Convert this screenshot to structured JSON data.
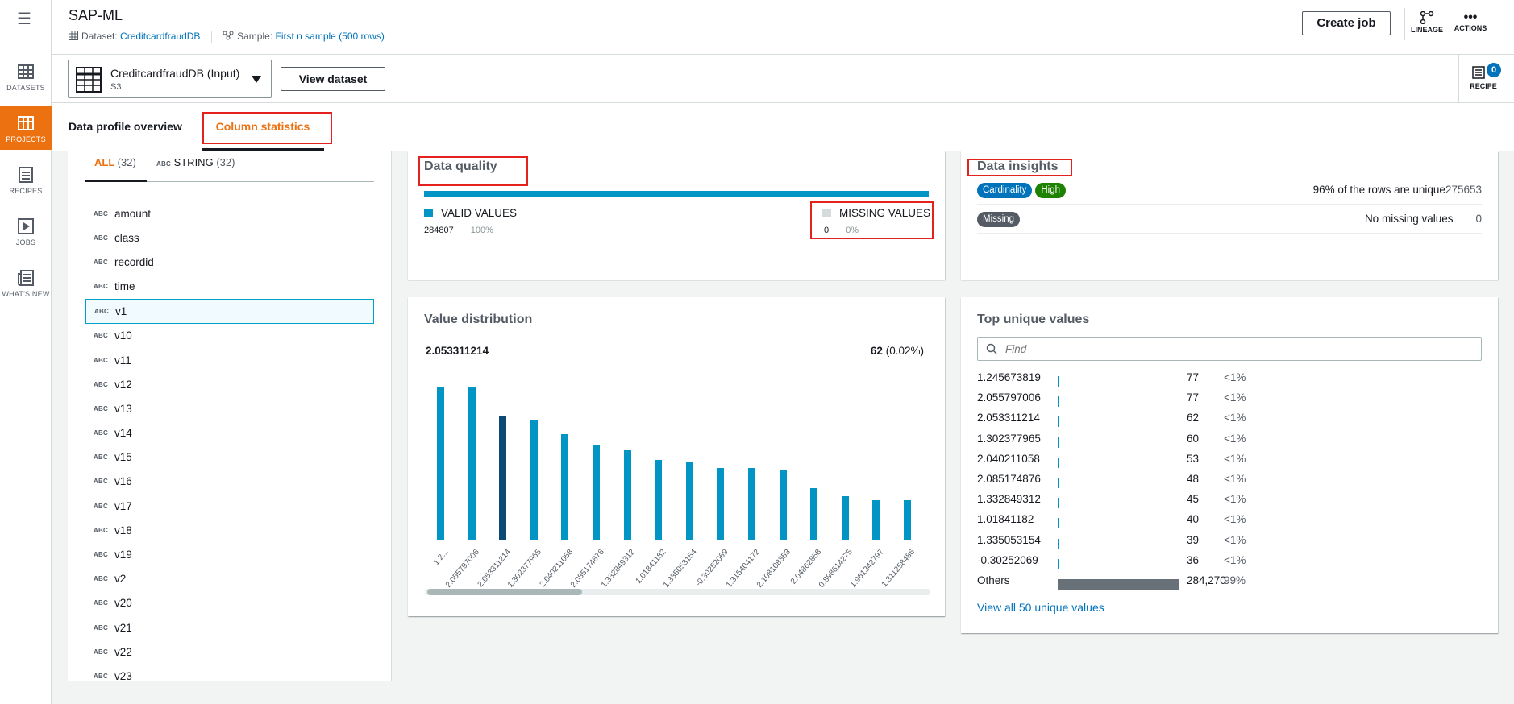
{
  "app": {
    "title": "SAP-ML",
    "menu_icon": "hamburger-icon"
  },
  "meta": {
    "dataset_label": "Dataset:",
    "dataset_value": "CreditcardfraudDB",
    "sample_label": "Sample:",
    "sample_value": "First n sample (500 rows)"
  },
  "leftnav": [
    {
      "label": "DATASETS",
      "icon": "table-icon"
    },
    {
      "label": "PROJECTS",
      "icon": "projects-icon",
      "active": true
    },
    {
      "label": "RECIPES",
      "icon": "recipe-icon"
    },
    {
      "label": "JOBS",
      "icon": "play-icon"
    },
    {
      "label": "WHAT'S NEW",
      "icon": "news-icon"
    }
  ],
  "toolbar": {
    "create_job": "Create job",
    "lineage": "LINEAGE",
    "actions": "ACTIONS",
    "recipe": "RECIPE",
    "recipe_count": "0"
  },
  "dataset_selector": {
    "name": "CreditcardfraudDB (Input)",
    "source": "S3",
    "view_button": "View dataset"
  },
  "tabs": {
    "overview": "Data profile overview",
    "column_stats": "Column statistics"
  },
  "filter_tabs": {
    "all_label": "ALL",
    "all_count": "(32)",
    "string_label": "STRING",
    "string_count": "(32)",
    "type_tag": "ABC"
  },
  "columns": [
    "amount",
    "class",
    "recordid",
    "time",
    "v1",
    "v10",
    "v11",
    "v12",
    "v13",
    "v14",
    "v15",
    "v16",
    "v17",
    "v18",
    "v19",
    "v2",
    "v20",
    "v21",
    "v22",
    "v23"
  ],
  "selected_column": "v1",
  "data_quality": {
    "title": "Data quality",
    "valid_label": "VALID VALUES",
    "valid_count": "284807",
    "valid_pct": "100%",
    "missing_label": "MISSING VALUES",
    "missing_count": "0",
    "missing_pct": "0%",
    "colors": {
      "valid": "#0095c4",
      "missing": "#d5dbdb"
    }
  },
  "data_insights": {
    "title": "Data insights",
    "row1": {
      "badge1": "Cardinality",
      "badge2": "High",
      "text": "96% of the rows are unique",
      "value": "275653"
    },
    "row2": {
      "badge1": "Missing",
      "text": "No missing values",
      "value": "0"
    }
  },
  "value_distribution": {
    "title": "Value distribution",
    "hover_value": "2.053311214",
    "hover_count": "62",
    "hover_pct": "(0.02%)"
  },
  "chart_data": {
    "type": "bar",
    "categories": [
      "1.2...",
      "2.055797006",
      "2.053311214",
      "1.302377965",
      "2.040211058",
      "2.085174876",
      "1.332849312",
      "1.01841182",
      "1.335053154",
      "-0.30252069",
      "1.315404172",
      "2.108108353",
      "2.04862858",
      "0.898614275",
      "1.961342797",
      "1.311258486"
    ],
    "values": [
      77,
      77,
      62,
      60,
      53,
      48,
      45,
      40,
      39,
      36,
      36,
      35,
      26,
      22,
      20,
      20
    ],
    "highlighted_index": 2,
    "colors": {
      "bar": "#0095c4",
      "highlight": "#0a4a74"
    }
  },
  "top_unique": {
    "title": "Top unique values",
    "find_placeholder": "Find",
    "rows": [
      {
        "value": "1.245673819",
        "count": "77",
        "pct": "<1%",
        "frac": 0.0003
      },
      {
        "value": "2.055797006",
        "count": "77",
        "pct": "<1%",
        "frac": 0.0003
      },
      {
        "value": "2.053311214",
        "count": "62",
        "pct": "<1%",
        "frac": 0.0002
      },
      {
        "value": "1.302377965",
        "count": "60",
        "pct": "<1%",
        "frac": 0.0002
      },
      {
        "value": "2.040211058",
        "count": "53",
        "pct": "<1%",
        "frac": 0.0002
      },
      {
        "value": "2.085174876",
        "count": "48",
        "pct": "<1%",
        "frac": 0.0002
      },
      {
        "value": "1.332849312",
        "count": "45",
        "pct": "<1%",
        "frac": 0.0002
      },
      {
        "value": "1.01841182",
        "count": "40",
        "pct": "<1%",
        "frac": 0.0001
      },
      {
        "value": "1.335053154",
        "count": "39",
        "pct": "<1%",
        "frac": 0.0001
      },
      {
        "value": "-0.30252069",
        "count": "36",
        "pct": "<1%",
        "frac": 0.0001
      },
      {
        "value": "Others",
        "count": "284,270",
        "pct": "99%",
        "frac": 0.99
      }
    ],
    "view_all": "View all 50 unique values"
  }
}
